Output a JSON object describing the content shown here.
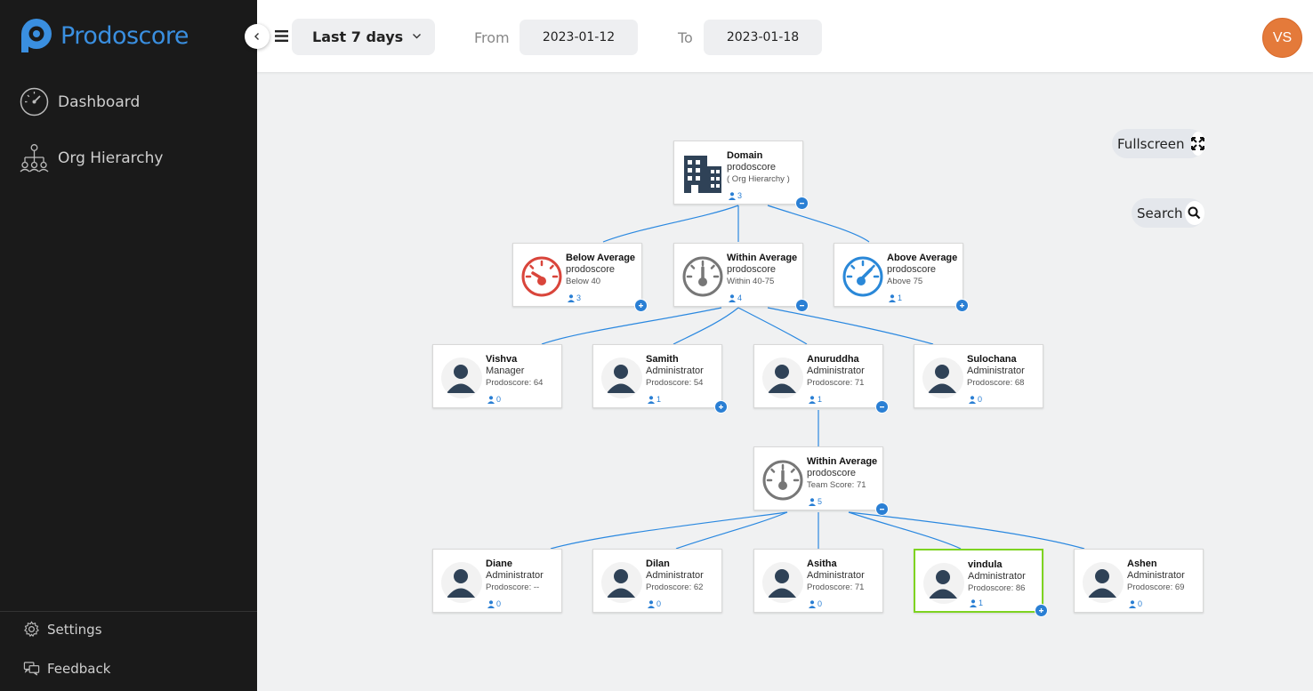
{
  "brand": {
    "name": "Prodoscore",
    "color": "#3a8fe0"
  },
  "nav": {
    "dashboard": "Dashboard",
    "org_hierarchy": "Org Hierarchy",
    "settings": "Settings",
    "feedback": "Feedback"
  },
  "topbar": {
    "range": "Last 7 days",
    "from_label": "From",
    "from_value": "2023-01-12",
    "to_label": "To",
    "to_value": "2023-01-18",
    "user_initials": "VS"
  },
  "controls": {
    "fullscreen": "Fullscreen",
    "search": "Search"
  },
  "tree": {
    "domain": {
      "name": "Domain",
      "sub": "prodoscore",
      "extra": "( Org Hierarchy )",
      "count": "3",
      "toggle": "minus"
    },
    "below": {
      "name": "Below Average",
      "sub": "prodoscore",
      "extra": "Below 40",
      "count": "3",
      "toggle": "plus"
    },
    "within": {
      "name": "Within Average",
      "sub": "prodoscore",
      "extra": "Within 40-75",
      "count": "4",
      "toggle": "minus"
    },
    "above": {
      "name": "Above Average",
      "sub": "prodoscore",
      "extra": "Above 75",
      "count": "1",
      "toggle": "plus"
    },
    "vishva": {
      "name": "Vishva",
      "sub": "Manager",
      "extra": "Prodoscore: 64",
      "count": "0"
    },
    "samith": {
      "name": "Samith",
      "sub": "Administrator",
      "extra": "Prodoscore: 54",
      "count": "1",
      "toggle": "plus"
    },
    "anuruddha": {
      "name": "Anuruddha",
      "sub": "Administrator",
      "extra": "Prodoscore: 71",
      "count": "1",
      "toggle": "minus"
    },
    "sulochana": {
      "name": "Sulochana",
      "sub": "Administrator",
      "extra": "Prodoscore: 68",
      "count": "0"
    },
    "team": {
      "name": "Within Average",
      "sub": "prodoscore",
      "extra": "Team Score: 71",
      "count": "5",
      "toggle": "minus"
    },
    "diane": {
      "name": "Diane",
      "sub": "Administrator",
      "extra": "Prodoscore: --",
      "count": "0"
    },
    "dilan": {
      "name": "Dilan",
      "sub": "Administrator",
      "extra": "Prodoscore: 62",
      "count": "0"
    },
    "asitha": {
      "name": "Asitha",
      "sub": "Administrator",
      "extra": "Prodoscore: 71",
      "count": "0"
    },
    "vindula": {
      "name": "vindula",
      "sub": "Administrator",
      "extra": "Prodoscore: 86",
      "count": "1",
      "toggle": "plus",
      "selected": true
    },
    "ashen": {
      "name": "Ashen",
      "sub": "Administrator",
      "extra": "Prodoscore: 69",
      "count": "0"
    }
  },
  "colors": {
    "link": "#2a7fd4",
    "gauge_below": "#d9453b",
    "gauge_within": "#777777",
    "gauge_above": "#2a88d8",
    "avatar_fill": "#2f4257",
    "selected_border": "#7ed321"
  }
}
